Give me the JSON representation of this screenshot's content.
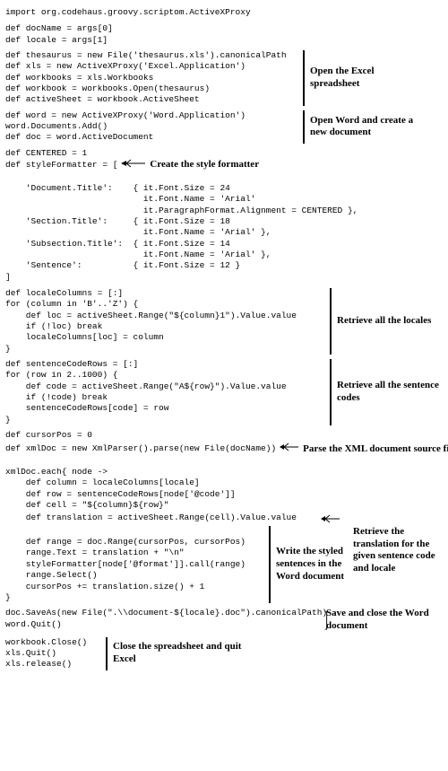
{
  "lines": {
    "import": "import org.codehaus.groovy.scriptom.ActiveXProxy",
    "docName": "def docName = args[0]",
    "locale": "def locale = args[1]",
    "thesaurus": "def thesaurus = new File('thesaurus.xls').canonicalPath",
    "xls": "def xls = new ActiveXProxy('Excel.Application')",
    "workbooks": "def workbooks = xls.Workbooks",
    "workbook": "def workbook = workbooks.Open(thesaurus)",
    "activeSheet": "def activeSheet = workbook.ActiveSheet",
    "word": "def word = new ActiveXProxy('Word.Application')",
    "documentsAdd": "word.Documents.Add()",
    "doc": "def doc = word.ActiveDocument",
    "centered": "def CENTERED = 1",
    "styleFormatter": "def styleFormatter = [",
    "docTitle1": "    'Document.Title':    { it.Font.Size = 24",
    "docTitle2": "                           it.Font.Name = 'Arial'",
    "docTitle3": "                           it.ParagraphFormat.Alignment = CENTERED },",
    "secTitle1": "    'Section.Title':     { it.Font.Size = 18",
    "secTitle2": "                           it.Font.Name = 'Arial' },",
    "subTitle1": "    'Subsection.Title':  { it.Font.Size = 14",
    "subTitle2": "                           it.Font.Name = 'Arial' },",
    "sentence": "    'Sentence':          { it.Font.Size = 12 }",
    "closeBracket": "]",
    "localeColumns": "def localeColumns = [:]",
    "forColumn": "for (column in 'B'..'Z') {",
    "loc": "    def loc = activeSheet.Range(\"${column}1\").Value.value",
    "ifLoc": "    if (!loc) break",
    "localeAssign": "    localeColumns[loc] = column",
    "close1": "}",
    "sentRows": "def sentenceCodeRows = [:]",
    "forRow": "for (row in 2..1000) {",
    "codeDef": "    def code = activeSheet.Range(\"A${row}\").Value.value",
    "ifCode": "    if (!code) break",
    "sentAssign": "    sentenceCodeRows[code] = row",
    "close2": "}",
    "cursorPos": "def cursorPos = 0",
    "xmlDoc": "def xmlDoc = new XmlParser().parse(new File(docName))",
    "xmlEach": "xmlDoc.each{ node ->",
    "column": "    def column = localeColumns[locale]",
    "row": "    def row = sentenceCodeRows[node['@code']]",
    "cell": "    def cell = \"${column}${row}\"",
    "translation": "    def translation = activeSheet.Range(cell).Value.value",
    "blank": "",
    "range": "    def range = doc.Range(cursorPos, cursorPos)",
    "rangeText": "    range.Text = translation + \"\\n\"",
    "styleCall": "    styleFormatter[node['@format']].call(range)",
    "rangeSelect": "    range.Select()",
    "cursorInc": "    cursorPos += translation.size() + 1",
    "close3": "}",
    "saveAs": "doc.SaveAs(new File(\".\\\\document-${locale}.doc\").canonicalPath)",
    "wordQuit": "word.Quit()",
    "wbClose": "workbook.Close()",
    "xlsQuit": "xls.Quit()",
    "xlsRelease": "xls.release()"
  },
  "notes": {
    "openExcel": "Open the Excel spreadsheet",
    "openWord": "Open Word and create a new document",
    "createStyle": "Create the style formatter",
    "retrieveLocales": "Retrieve all the locales",
    "retrieveCodes": "Retrieve all the sentence codes",
    "parseXml": "Parse the XML document source file",
    "retrieveTranslation": "Retrieve the translation for the given sentence code and locale",
    "writeStyled": "Write the styled sentences in the Word document",
    "saveClose": "Save and close the Word document",
    "closeExcel": "Close the spreadsheet and quit Excel"
  }
}
